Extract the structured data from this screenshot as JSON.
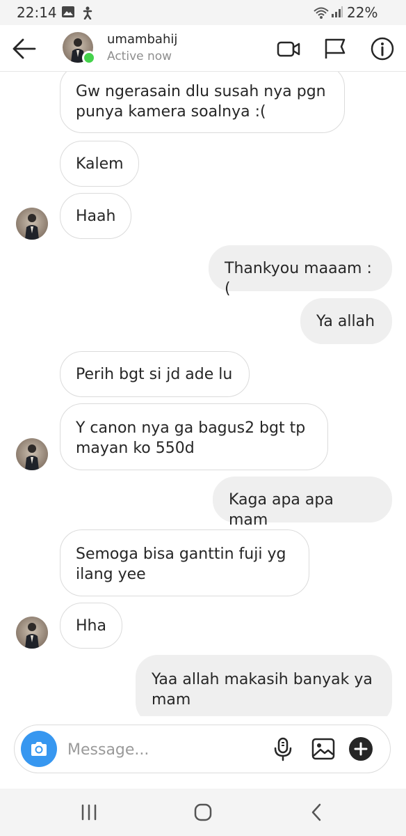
{
  "status_bar": {
    "time": "22:14",
    "battery": "22%",
    "icons": [
      "gallery-icon",
      "accessibility-icon",
      "wifi-icon",
      "signal-icon"
    ]
  },
  "header": {
    "username": "umambahij",
    "status": "Active now",
    "icons": [
      "back-arrow-icon",
      "video-call-icon",
      "flag-icon",
      "info-icon"
    ],
    "active_color": "#45d24c"
  },
  "messages": [
    {
      "side": "in",
      "text": "Gw ngerasain dlu susah nya pgn\npunya kamera soalnya :("
    },
    {
      "side": "in",
      "text": "Kalem"
    },
    {
      "side": "in",
      "text": "Haah",
      "avatar": true
    },
    {
      "side": "out",
      "text": "Thankyou maaam :("
    },
    {
      "side": "out",
      "text": "Ya allah"
    },
    {
      "side": "in",
      "text": "Perih bgt si jd ade lu"
    },
    {
      "side": "in",
      "text": "Y canon nya ga bagus2 bgt tp\nmayan ko 550d",
      "avatar": true
    },
    {
      "side": "out",
      "text": "Kaga apa apa mam"
    },
    {
      "side": "in",
      "text": "Semoga bisa ganttin fuji yg\nilang yee"
    },
    {
      "side": "in",
      "text": "Hha",
      "avatar": true
    },
    {
      "side": "out",
      "text": "Yaa allah makasih banyak ya\nmam"
    }
  ],
  "composer": {
    "placeholder": "Message...",
    "accent_color": "#3797f0",
    "icons": [
      "camera-icon",
      "microphone-icon",
      "gallery-icon",
      "plus-icon"
    ]
  },
  "nav_bar": {
    "icons": [
      "recent-apps-icon",
      "home-icon",
      "back-icon"
    ]
  }
}
